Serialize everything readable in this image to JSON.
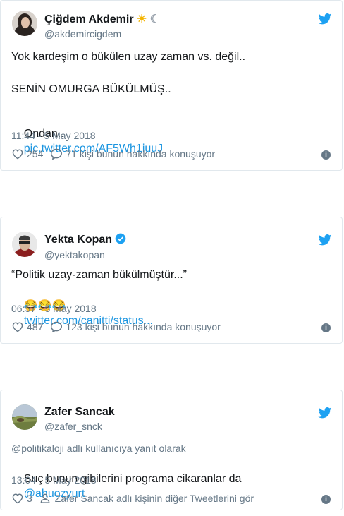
{
  "tweets": [
    {
      "name": "Çiğdem Akdemir",
      "name_emoji": "☀",
      "name_emoji2": "☾",
      "handle": "@akdemircigdem",
      "text_line1": "Yok kardeşim o bükülen uzay zaman vs. değil..",
      "text_line2": "SENİN OMURGA BÜKÜLMÜŞ..",
      "text_line3_prefix": "Ondan..",
      "text_link": "pic.twitter.com/AF5Wh1iuuJ",
      "time": "11:44 - 5 May 2018",
      "likes": "254",
      "replies": "71 kişi bunun hakkında konuşuyor"
    },
    {
      "name": "Yekta Kopan",
      "handle": "@yektakopan",
      "text_line1": "“Politik uzay-zaman bükülmüştür...”",
      "emojis": "😂😂😂",
      "text_link": "twitter.com/canitti/status...",
      "time": "06:57 - 5 May 2018",
      "likes": "487",
      "replies": "123 kişi bunun hakkında konuşuyor"
    },
    {
      "name": "Zafer Sancak",
      "handle": "@zafer_snck",
      "reply_to": "@politikaloji adlı kullanıcıya yanıt olarak",
      "text_prefix": "Suç bunun gibilerini programa cikaranlar da",
      "text_mention": "@ahuozyurt",
      "time": "13:04 - 5 May 2018",
      "likes": "3",
      "more_text": "Zafer Sancak adlı kişinin diğer Tweetlerini gör"
    }
  ],
  "colors": {
    "link": "#1b95e0",
    "muted": "#657786",
    "bird": "#1da1f2",
    "border": "#e1e8ed"
  },
  "icons": [
    "twitter-bird-icon",
    "heart-icon",
    "reply-bubble-icon",
    "info-icon",
    "verified-badge-icon",
    "person-icon"
  ]
}
